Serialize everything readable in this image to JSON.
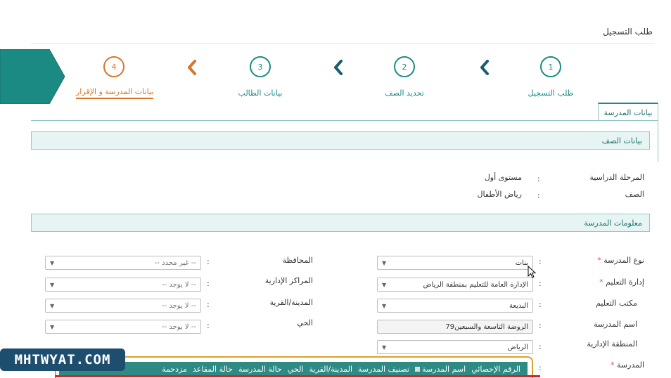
{
  "page": {
    "title": "طلب التسجيل"
  },
  "steps": [
    {
      "number": "1",
      "label": "طلب التسجيل",
      "active": false
    },
    {
      "number": "2",
      "label": "تحديد الصف",
      "active": false
    },
    {
      "number": "3",
      "label": "بيانات الطالب",
      "active": false
    },
    {
      "number": "4",
      "label": "بيانات المدرسة و الإقرار",
      "active": true
    }
  ],
  "section_tab": {
    "label": "بيانات المدرسة"
  },
  "class_panel": {
    "title": "بيانات الصف",
    "rows": [
      {
        "label": "المرحلة الدراسية",
        "value": "مستوى أول"
      },
      {
        "label": "الصف",
        "value": "رياض الأطفال"
      }
    ]
  },
  "school_panel": {
    "title": "معلومات المدرسة",
    "right_fields": [
      {
        "label": "نوع المدرسة",
        "value": "بنات",
        "required": true,
        "type": "select"
      },
      {
        "label": "إدارة التعليم",
        "value": "الإدارة العامة للتعليم بمنطقة الرياض",
        "required": true,
        "type": "select"
      },
      {
        "label": "مكتب التعليم",
        "value": "البديعة",
        "required": false,
        "type": "select"
      },
      {
        "label": "اسم المدرسة",
        "value": "الروضة التاسعة والسبعين79",
        "required": false,
        "type": "text"
      },
      {
        "label": "المنطقة الإدارية",
        "value": "الرياض",
        "required": false,
        "type": "select"
      }
    ],
    "left_fields": [
      {
        "label": "المحافظة",
        "value": "-- غير محدد --"
      },
      {
        "label": "المراكز الإدارية",
        "value": "-- لا يوجد --"
      },
      {
        "label": "المدينة/القرية",
        "value": "-- لا يوجد --"
      },
      {
        "label": "الحي",
        "value": "-- لا يوجد --"
      }
    ],
    "school_label": "المدرسة",
    "colon": ":",
    "columns": [
      "الرقم الإحصائي",
      "اسم المدرسة",
      "تصنيف المدرسة",
      "المدينة/القرية",
      "الحي",
      "حالة المدرسة",
      "حالة المقاعد",
      "مزدحمة"
    ]
  },
  "watermark": "MHTWYAT.COM",
  "colors": {
    "teal": "#1a8a83",
    "orange": "#d9742b",
    "panel_bg": "#e6f4f3",
    "grid_header": "#2e8a84"
  }
}
